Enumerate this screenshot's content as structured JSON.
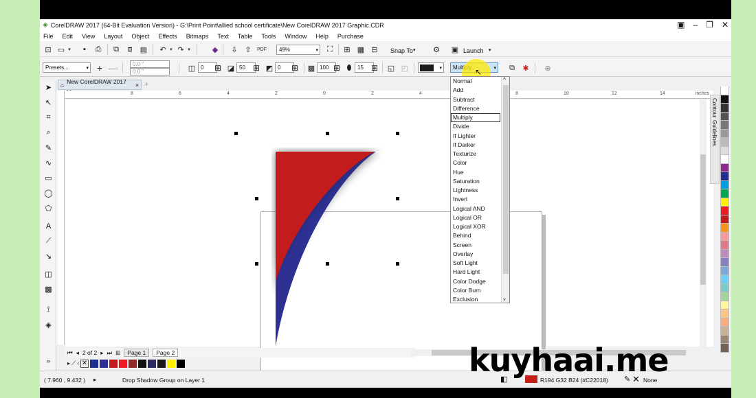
{
  "window": {
    "title": "CorelDRAW 2017 (64-Bit Evaluation Version) - G:\\Print Point\\allied school certificate\\New CorelDRAW 2017 Graphic.CDR"
  },
  "menu": [
    "File",
    "Edit",
    "View",
    "Layout",
    "Object",
    "Effects",
    "Bitmaps",
    "Text",
    "Table",
    "Tools",
    "Window",
    "Help",
    "Purchase"
  ],
  "standard_toolbar": {
    "zoom": "49%",
    "snap_to": "Snap To",
    "launch": "Launch"
  },
  "property_bar": {
    "presets": "Presets...",
    "x_offset": "0.0 \"",
    "y_offset": "0.0 \"",
    "shadow_angle": "0",
    "opacity": "50",
    "feather": "0",
    "fade": "100",
    "stretch": "15",
    "merge_mode": "Multiply",
    "color_accent": "#1c1c1c"
  },
  "document_tab": "New CorelDRAW 2017 ...",
  "ruler": {
    "unit": "inches",
    "ticks": [
      "8",
      "6",
      "4",
      "2",
      "0",
      "2",
      "4",
      "6",
      "8",
      "10",
      "12",
      "14"
    ]
  },
  "merge_mode_options": [
    "Normal",
    "Add",
    "Subtract",
    "Difference",
    "Multiply",
    "Divide",
    "If Lighter",
    "If Darker",
    "Texturize",
    "Color",
    "Hue",
    "Saturation",
    "Lightness",
    "Invert",
    "Logical AND",
    "Logical OR",
    "Logical XOR",
    "Behind",
    "Screen",
    "Overlay",
    "Soft Light",
    "Hard Light",
    "Color Dodge",
    "Color Burn",
    "Exclusion"
  ],
  "merge_mode_selected_index": 4,
  "artwork": {
    "red": "#c21c1c",
    "blue": "#2e3192"
  },
  "dockers": [
    "Contour",
    "Guidelines"
  ],
  "palette_colors": [
    "#ffffff",
    "#111111",
    "#333333",
    "#555555",
    "#777777",
    "#999999",
    "#bbbbbb",
    "#dddddd",
    "#ffffff",
    "#8e2a8e",
    "#1f2f8f",
    "#00a0e0",
    "#00a651",
    "#fff200",
    "#ed1c24",
    "#c21c1c",
    "#f7941d",
    "#f6989d",
    "#e07a8a",
    "#bd8cbf",
    "#8781bd",
    "#7da7d9",
    "#6dcff6",
    "#7accc8",
    "#a3d39c",
    "#fff799",
    "#fdc689",
    "#f9ad81",
    "#c7b299",
    "#998675",
    "#736357"
  ],
  "page_nav": {
    "counter": "2 of 2",
    "pages": [
      "Page 1",
      "Page 2"
    ]
  },
  "document_palette": [
    "#1f2f8f",
    "#2e3192",
    "#c21c1c",
    "#ed1c24",
    "#8e2a2a",
    "#111111",
    "#2a2a60",
    "#181818",
    "#fff200",
    "#000000"
  ],
  "status": {
    "coords": "( 7.960 , 9.432 )",
    "message": "Drop Shadow Group on Layer 1",
    "fill_info": "R194 G32 B24 (#C22018)",
    "outline": "None",
    "fill_color": "#c22018"
  },
  "watermark": "kuyhaai.me"
}
